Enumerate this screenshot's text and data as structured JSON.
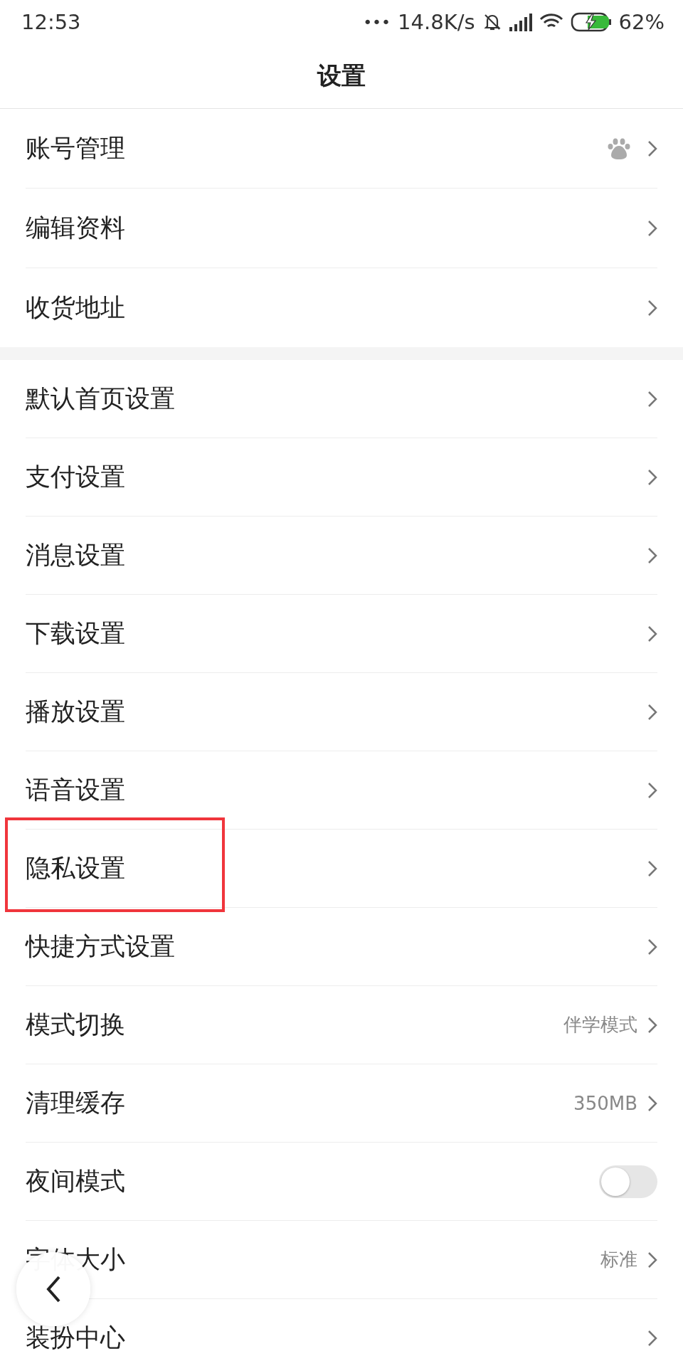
{
  "status_bar": {
    "time": "12:53",
    "dots": "•••",
    "speed": "14.8K/s",
    "battery": "62%"
  },
  "header": {
    "title": "设置"
  },
  "groups": [
    {
      "items": [
        {
          "kind": "link",
          "label": "账号管理",
          "highlighted": false
        },
        {
          "kind": "link",
          "label": "编辑资料",
          "highlighted": false
        },
        {
          "kind": "link",
          "label": "收货地址",
          "highlighted": false
        }
      ]
    },
    {
      "items": [
        {
          "kind": "link",
          "label": "默认首页设置",
          "highlighted": false
        },
        {
          "kind": "link",
          "label": "支付设置",
          "highlighted": false
        },
        {
          "kind": "link",
          "label": "消息设置",
          "highlighted": false
        },
        {
          "kind": "link",
          "label": "下载设置",
          "highlighted": false
        },
        {
          "kind": "link",
          "label": "播放设置",
          "highlighted": false
        },
        {
          "kind": "link",
          "label": "语音设置",
          "highlighted": false
        },
        {
          "kind": "link",
          "label": "隐私设置",
          "highlighted": true
        },
        {
          "kind": "link",
          "label": "快捷方式设置",
          "highlighted": false
        },
        {
          "kind": "link",
          "label": "模式切换",
          "value": "伴学模式",
          "highlighted": false
        },
        {
          "kind": "link",
          "label": "清理缓存",
          "value": "350MB",
          "highlighted": false
        },
        {
          "kind": "toggle",
          "label": "夜间模式",
          "on": false,
          "highlighted": false
        },
        {
          "kind": "link",
          "label": "字体大小",
          "value": "标准",
          "highlighted": false
        },
        {
          "kind": "link",
          "label": "装扮中心",
          "highlighted": false
        }
      ]
    }
  ]
}
